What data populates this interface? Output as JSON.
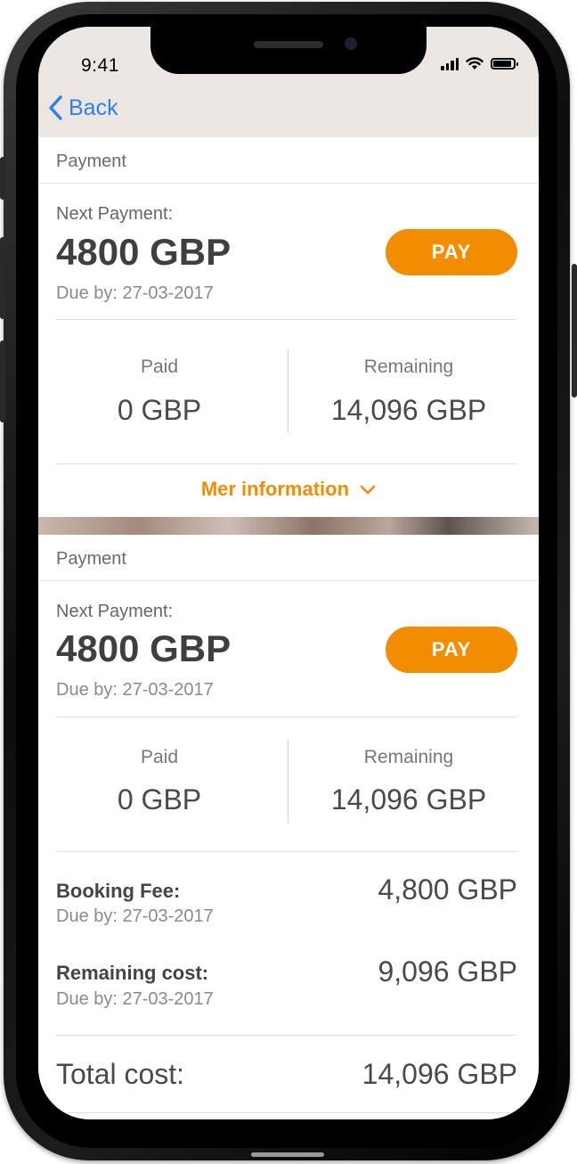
{
  "status_bar": {
    "time": "9:41"
  },
  "nav": {
    "back_label": "Back"
  },
  "colors": {
    "accent": "#f28c00",
    "link": "#2f80ed"
  },
  "card1": {
    "header": "Payment",
    "next_payment_label": "Next Payment:",
    "amount": "4800 GBP",
    "due": "Due by: 27-03-2017",
    "pay_label": "PAY",
    "paid_label": "Paid",
    "paid_value": "0 GBP",
    "remaining_label": "Remaining",
    "remaining_value": "14,096 GBP",
    "more_info_label": "Mer information"
  },
  "card2": {
    "header": "Payment",
    "next_payment_label": "Next Payment:",
    "amount": "4800 GBP",
    "due": "Due by: 27-03-2017",
    "pay_label": "PAY",
    "paid_label": "Paid",
    "paid_value": "0 GBP",
    "remaining_label": "Remaining",
    "remaining_value": "14,096 GBP",
    "booking_fee_label": "Booking Fee:",
    "booking_fee_due": "Due by: 27-03-2017",
    "booking_fee_value": "4,800 GBP",
    "remaining_cost_label": "Remaining cost:",
    "remaining_cost_due": "Due by: 27-03-2017",
    "remaining_cost_value": "9,096 GBP",
    "total_label": "Total cost:",
    "total_value": "14,096 GBP"
  }
}
